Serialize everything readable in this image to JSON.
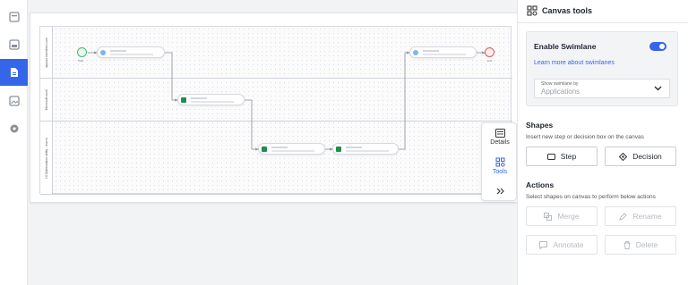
{
  "panel": {
    "title": "Canvas tools",
    "swimlane": {
      "title": "Enable Swimlane",
      "enabled": true,
      "learn_more": "Learn more about swimlanes",
      "show_by_label": "Show swimlane by",
      "show_by_value": "Applications"
    },
    "shapes": {
      "title": "Shapes",
      "subtitle": "Insert new step or decision box on the canvas",
      "step_label": "Step",
      "decision_label": "Decision"
    },
    "actions": {
      "title": "Actions",
      "subtitle": "Select shapes on canvas to perform below actions",
      "merge_label": "Merge",
      "rename_label": "Rename",
      "annotate_label": "Annotate",
      "delete_label": "Delete"
    }
  },
  "floating_bar": {
    "details_label": "Details",
    "tools_label": "Tools"
  },
  "canvas": {
    "lanes": [
      "appian.incentivio.com",
      "Microsoft excel",
      "UI Optimization utility - macro"
    ],
    "start_label": "Start",
    "end_label": "End"
  },
  "colors": {
    "accent": "#3566ea",
    "start": "#3dbb6b",
    "end": "#e25b5b",
    "excel": "#1d8f4e"
  },
  "icons": {
    "rail": [
      "dashboard-icon",
      "grid-icon",
      "document-icon",
      "image-icon",
      "settings-icon"
    ],
    "panel_header": "canvas-tools-icon"
  }
}
